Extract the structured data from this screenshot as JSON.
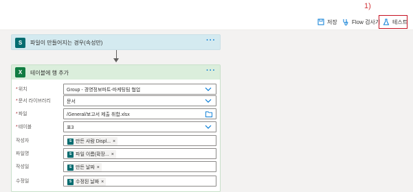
{
  "annotation": {
    "marker": "1)"
  },
  "commandbar": {
    "save": {
      "label": "저장",
      "icon": "save-icon"
    },
    "flow_checker": {
      "label": "Flow 검사기",
      "icon": "stethoscope-icon"
    },
    "test": {
      "label": "테스트",
      "icon": "flask-icon"
    }
  },
  "trigger_card": {
    "icon_text": "S",
    "title": "파일이 만들어지는 경우(속성만)",
    "menu": "···"
  },
  "action_card": {
    "icon_text": "X",
    "title": "테이블에 행 추가",
    "menu": "···",
    "fields": [
      {
        "label": "위치",
        "required": "*",
        "value": "Group - 경영정보파트-마케팅팀 협업",
        "control": "dropdown"
      },
      {
        "label": "문서 라이브러리",
        "required": "*",
        "value": "문서",
        "control": "dropdown"
      },
      {
        "label": "파일",
        "required": "*",
        "value": "/General/보고서 제출 취합.xlsx",
        "control": "file-picker"
      },
      {
        "label": "테이블",
        "required": "*",
        "value": "표3",
        "control": "dropdown"
      },
      {
        "label": "작성자",
        "token": "만든 사람 Displ...",
        "token_close": "×"
      },
      {
        "label": "파일명",
        "token": "파일 이름(확장...",
        "token_close": "×"
      },
      {
        "label": "작성일",
        "token": "만든 날짜",
        "token_close": "×"
      },
      {
        "label": "수정일",
        "token": "수정된 날짜",
        "token_close": "×"
      }
    ]
  },
  "colors": {
    "accent": "#0078d4",
    "sharepoint": "#036c70",
    "excel": "#107c41",
    "highlight_box": "#c50f1f"
  }
}
